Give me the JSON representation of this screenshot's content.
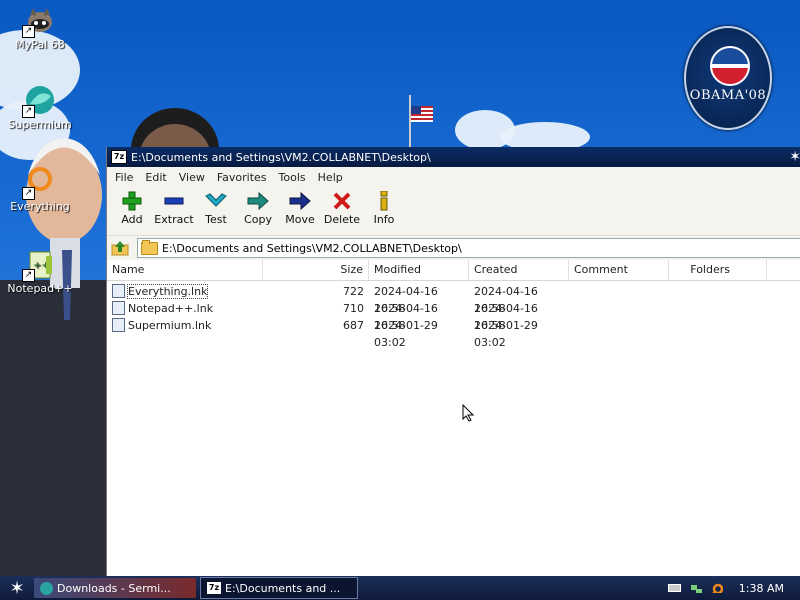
{
  "desktop": {
    "icons": [
      {
        "label": "MyPal 68"
      },
      {
        "label": "Supermium"
      },
      {
        "label": "Everything"
      },
      {
        "label": "Notepad++"
      }
    ],
    "seal_text": "OBAMA'08"
  },
  "window": {
    "title": "E:\\Documents and Settings\\VM2.COLLABNET\\Desktop\\",
    "app_icon": "7z",
    "menu": [
      "File",
      "Edit",
      "View",
      "Favorites",
      "Tools",
      "Help"
    ],
    "toolbar": [
      {
        "label": "Add",
        "icon": "plus-icon",
        "color": "#1fa21f"
      },
      {
        "label": "Extract",
        "icon": "minus-icon",
        "color": "#1b3fb5"
      },
      {
        "label": "Test",
        "icon": "check-chevron-icon",
        "color": "#21a8c9"
      },
      {
        "label": "Copy",
        "icon": "arrow-right-icon",
        "color": "#1f8b7e"
      },
      {
        "label": "Move",
        "icon": "arrow-right-icon",
        "color": "#1b2f8c"
      },
      {
        "label": "Delete",
        "icon": "cross-icon",
        "color": "#d11b1b"
      },
      {
        "label": "Info",
        "icon": "info-icon",
        "color": "#d9b20f"
      }
    ],
    "address": "E:\\Documents and Settings\\VM2.COLLABNET\\Desktop\\",
    "columns": {
      "name": "Name",
      "size": "Size",
      "modified": "Modified",
      "created": "Created",
      "comment": "Comment",
      "folders": "Folders"
    },
    "files": [
      {
        "name": "Everything.lnk",
        "size": "722",
        "modified": "2024-04-16 16:58",
        "created": "2024-04-16 16:58"
      },
      {
        "name": "Notepad++.lnk",
        "size": "710",
        "modified": "2024-04-16 16:58",
        "created": "2024-04-16 16:58"
      },
      {
        "name": "Supermium.lnk",
        "size": "687",
        "modified": "2024-01-29 03:02",
        "created": "2024-01-29 03:02"
      }
    ]
  },
  "taskbar": {
    "tasks": [
      {
        "label": "Downloads - Sermi..."
      },
      {
        "label": "E:\\Documents and ..."
      }
    ],
    "clock": "1:38 AM"
  }
}
